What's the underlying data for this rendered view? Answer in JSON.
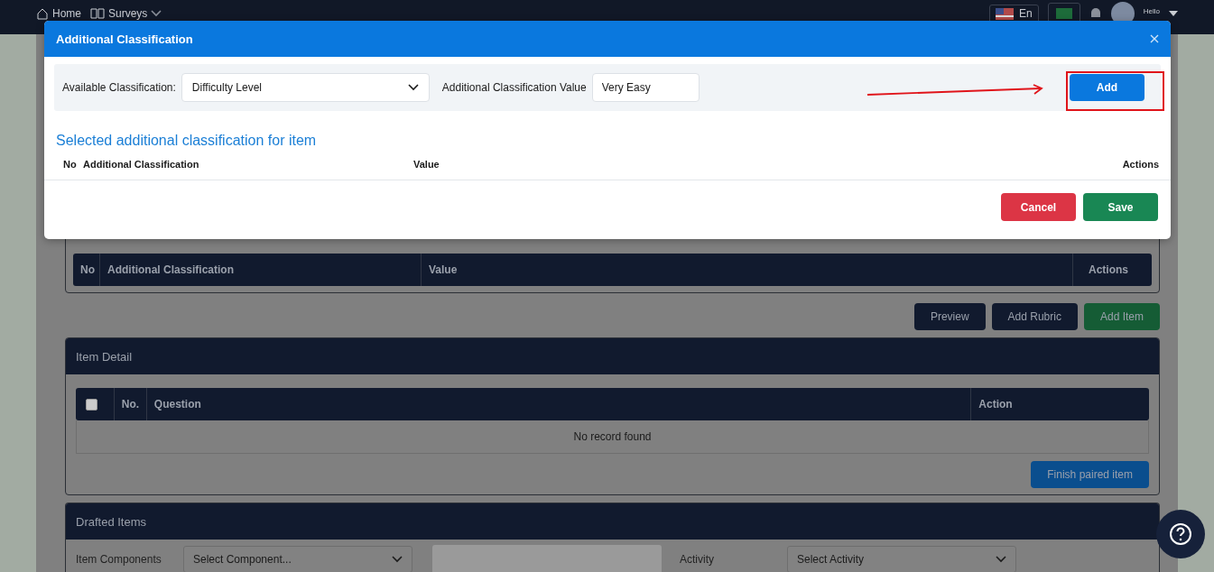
{
  "nav": {
    "home": "Home",
    "surveys": "Surveys",
    "language": "En",
    "greeting": "Hello"
  },
  "modal": {
    "title": "Additional Classification",
    "available_label": "Available Classification:",
    "available_value": "Difficulty Level",
    "value_label": "Additional Classification Value",
    "value_input": "Very Easy",
    "add_button": "Add",
    "section_title": "Selected additional classification for item",
    "columns": [
      "No",
      "Additional Classification",
      "Value",
      "Actions"
    ],
    "cancel_button": "Cancel",
    "save_button": "Save"
  },
  "classification_table": {
    "columns": [
      "No",
      "Additional Classification",
      "Value",
      "Actions"
    ]
  },
  "actions": [
    {
      "label": "Preview",
      "kind": "dark"
    },
    {
      "label": "Add Rubric",
      "kind": "dark"
    },
    {
      "label": "Add Item",
      "kind": "success"
    }
  ],
  "item_detail": {
    "title": "Item Detail",
    "select_all_checked": false,
    "columns": [
      "No.",
      "Question",
      "Action"
    ],
    "empty_text": "No record found",
    "finish_button": "Finish paired item"
  },
  "drafted_items": {
    "title": "Drafted Items",
    "fields": [
      {
        "label": "Item Components",
        "placeholder": "Select Component..."
      },
      {
        "label": "Activity",
        "placeholder": "Select Activity"
      }
    ]
  }
}
